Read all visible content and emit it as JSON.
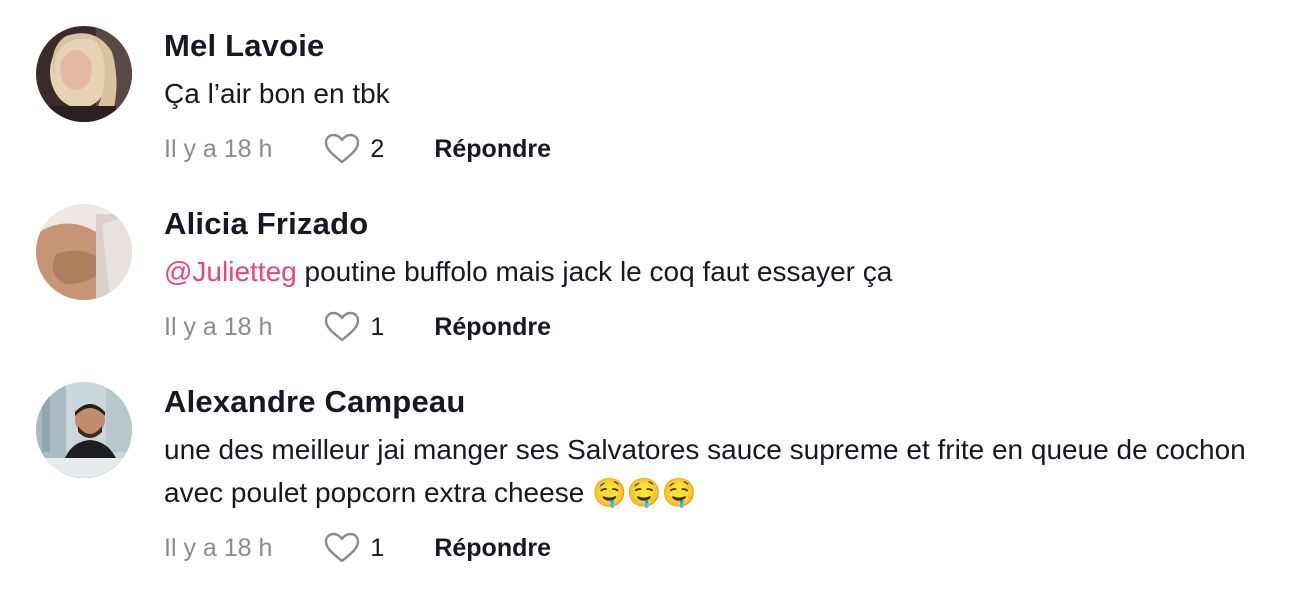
{
  "comments": [
    {
      "author": "Mel Lavoie",
      "mention": "",
      "text": "Ça l’air bon en tbk",
      "time": "Il y a 18 h",
      "likes": "2",
      "reply_label": "Répondre",
      "avatar_icon": "user-avatar-photo"
    },
    {
      "author": "Alicia Frizado",
      "mention": "@Julietteg",
      "text": " poutine buffolo mais jack le coq faut essayer ça",
      "time": "Il y a 18 h",
      "likes": "1",
      "reply_label": "Répondre",
      "avatar_icon": "user-avatar-photo"
    },
    {
      "author": "Alexandre Campeau",
      "mention": "",
      "text": "une des meilleur jai manger ses Salvatores sauce supreme et frite en queue de cochon avec poulet popcorn extra cheese 🤤🤤🤤",
      "time": "Il y a 18 h",
      "likes": "1",
      "reply_label": "Répondre",
      "avatar_icon": "user-avatar-photo"
    }
  ],
  "colors": {
    "text": "#161823",
    "muted": "#8a8b91",
    "mention": "#e8457d"
  }
}
